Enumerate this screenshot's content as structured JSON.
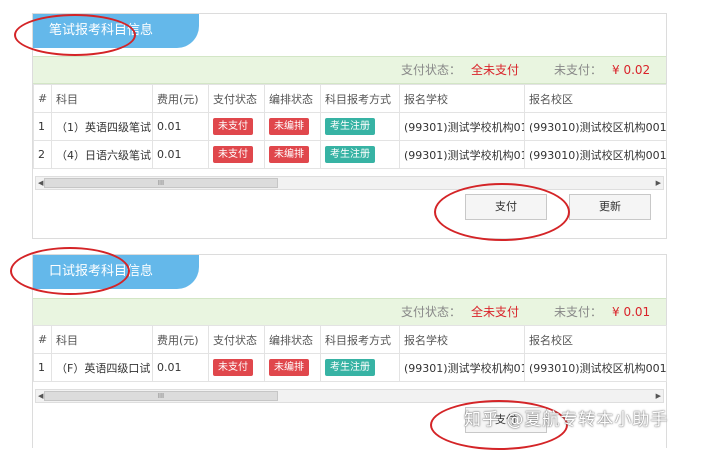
{
  "written": {
    "tab_title": "笔试报考科目信息",
    "status_label": "支付状态：",
    "status_value": "全未支付",
    "unpaid_label": "未支付：",
    "unpaid_value": "¥ 0.02",
    "headers": [
      "#",
      "科目",
      "费用(元)",
      "支付状态",
      "编排状态",
      "科目报考方式",
      "报名学校",
      "报名校区"
    ],
    "rows": [
      {
        "idx": "1",
        "subject": "（1）英语四级笔试",
        "fee": "0.01",
        "pay": "未支付",
        "arrange": "未编排",
        "method": "考生注册",
        "school": "(99301)测试学校机构01",
        "campus": "(993010)测试校区机构001"
      },
      {
        "idx": "2",
        "subject": "（4）日语六级笔试",
        "fee": "0.01",
        "pay": "未支付",
        "arrange": "未编排",
        "method": "考生注册",
        "school": "(99301)测试学校机构01",
        "campus": "(993010)测试校区机构001"
      }
    ],
    "scroll_grip": "III",
    "pay_button": "支付",
    "refresh_button": "更新"
  },
  "oral": {
    "tab_title": "口试报考科目信息",
    "status_label": "支付状态：",
    "status_value": "全未支付",
    "unpaid_label": "未支付：",
    "unpaid_value": "¥ 0.01",
    "headers": [
      "#",
      "科目",
      "费用(元)",
      "支付状态",
      "编排状态",
      "科目报考方式",
      "报名学校",
      "报名校区"
    ],
    "rows": [
      {
        "idx": "1",
        "subject": "（F）英语四级口试",
        "fee": "0.01",
        "pay": "未支付",
        "arrange": "未编排",
        "method": "考生注册",
        "school": "(99301)测试学校机构01",
        "campus": "(993010)测试校区机构001"
      }
    ],
    "scroll_grip": "III",
    "pay_button": "支付"
  },
  "watermark": "知乎 @夏航专转本小助手",
  "colors": {
    "tab_blue": "#64b8ea",
    "status_bg": "#e9f5e0",
    "badge_red": "#e0474c",
    "badge_teal": "#37b3a4",
    "annotation_red": "#d42427"
  }
}
